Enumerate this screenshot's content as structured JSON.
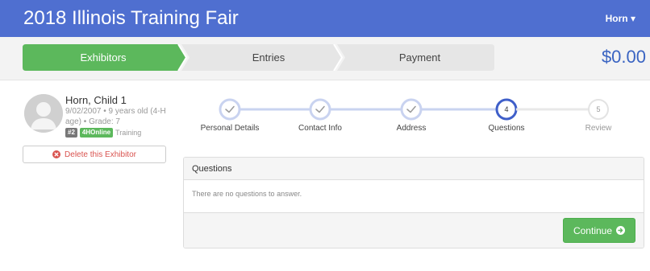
{
  "header": {
    "title": "2018 Illinois Training Fair",
    "user_menu": "Horn ▾"
  },
  "cart": {
    "steps": [
      "Exhibitors",
      "Entries",
      "Payment"
    ],
    "active_step": "Exhibitors",
    "total": "$0.00"
  },
  "exhibitor": {
    "name": "Horn, Child 1",
    "details_line1": "9/02/2007 • 9 years old (4-H",
    "details_line2": "age) • Grade: 7",
    "badge_number": "#2",
    "badge_program": "4HOnline",
    "badge_suffix": "Training",
    "delete_label": "Delete this Exhibitor"
  },
  "steps": [
    {
      "label": "Personal Details",
      "status": "complete",
      "number": ""
    },
    {
      "label": "Contact Info",
      "status": "complete",
      "number": ""
    },
    {
      "label": "Address",
      "status": "complete",
      "number": ""
    },
    {
      "label": "Questions",
      "status": "active",
      "number": "4"
    },
    {
      "label": "Review",
      "status": "future",
      "number": "5"
    }
  ],
  "questions": {
    "heading": "Questions",
    "empty_message": "There are no questions to answer.",
    "continue_label": "Continue"
  },
  "colors": {
    "navbar": "#4f6fd0",
    "complete_step": "#5cb85c",
    "active_step": "#3f5fc9",
    "step_track": "#c9d3f0",
    "danger": "#d9534f",
    "total": "#3a64c2"
  }
}
